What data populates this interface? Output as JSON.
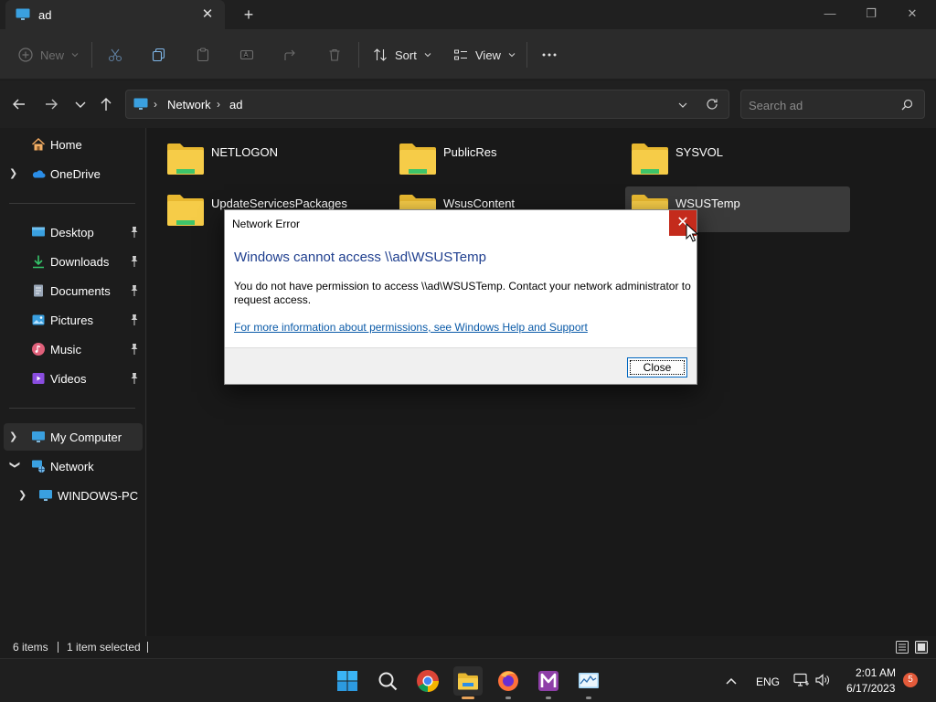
{
  "window": {
    "tab_title": "ad",
    "new_tab_icon": "plus-icon"
  },
  "commandbar": {
    "new_label": "New",
    "sort_label": "Sort",
    "view_label": "View"
  },
  "address": {
    "crumbs": [
      "Network",
      "ad"
    ],
    "search_placeholder": "Search ad"
  },
  "nav": {
    "home": "Home",
    "onedrive": "OneDrive",
    "desktop": "Desktop",
    "downloads": "Downloads",
    "documents": "Documents",
    "pictures": "Pictures",
    "music": "Music",
    "videos": "Videos",
    "my_computer": "My Computer",
    "network": "Network",
    "windows_pc": "WINDOWS-PC"
  },
  "folders": [
    "NETLOGON",
    "PublicRes",
    "SYSVOL",
    "UpdateServicesPackages",
    "WsusContent",
    "WSUSTemp"
  ],
  "status": {
    "items": "6 items",
    "selected": "1 item selected"
  },
  "dialog": {
    "title": "Network Error",
    "heading": "Windows cannot access \\\\ad\\WSUSTemp",
    "message": "You do not have permission to access \\\\ad\\WSUSTemp. Contact your network administrator to request access.",
    "link": "For more information about permissions, see Windows Help and Support",
    "close_button": "Close"
  },
  "tray": {
    "language": "ENG",
    "time": "2:01 AM",
    "date": "6/17/2023",
    "notification_count": "5"
  },
  "colors": {
    "accent": "#0067c0",
    "dialog_close_bg": "#c42b1c",
    "heading_blue": "#1f3f8f",
    "folder_yellow": "#f6cc48"
  }
}
